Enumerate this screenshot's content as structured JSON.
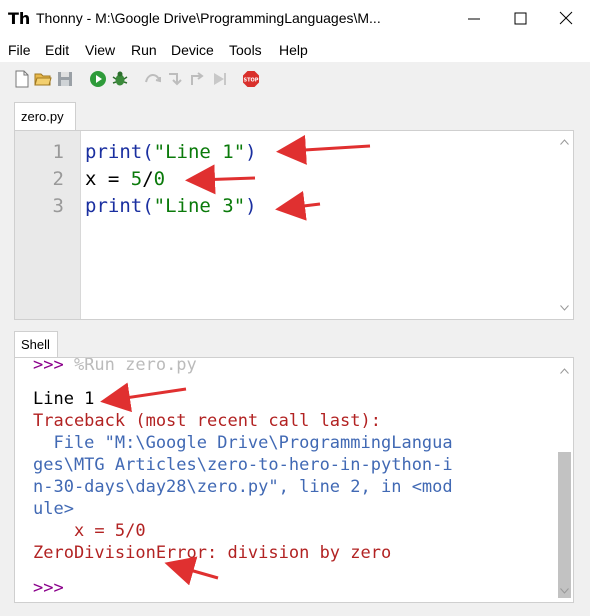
{
  "window": {
    "title": "Thonny  -  M:\\Google Drive\\ProgrammingLanguages\\M..."
  },
  "menu": [
    "File",
    "Edit",
    "View",
    "Run",
    "Device",
    "Tools",
    "Help"
  ],
  "editor": {
    "tab": "zero.py",
    "lines": [
      {
        "num": "1",
        "parts": [
          {
            "t": "print(",
            "c": "#1a2fa0"
          },
          {
            "t": "\"Line 1\"",
            "c": "#0a7a0a"
          },
          {
            "t": ")",
            "c": "#1a2fa0"
          }
        ]
      },
      {
        "num": "2",
        "parts": [
          {
            "t": "x = ",
            "c": "#000000"
          },
          {
            "t": "5",
            "c": "#0a7a0a"
          },
          {
            "t": "/",
            "c": "#000000"
          },
          {
            "t": "0",
            "c": "#0a7a0a"
          }
        ]
      },
      {
        "num": "3",
        "parts": [
          {
            "t": "print(",
            "c": "#1a2fa0"
          },
          {
            "t": "\"Line 3\"",
            "c": "#0a7a0a"
          },
          {
            "t": ")",
            "c": "#1a2fa0"
          }
        ]
      }
    ]
  },
  "shell": {
    "tab": "Shell",
    "run_cmd": ">>> %Run zero.py",
    "output_line": "Line 1",
    "traceback": "Traceback (most recent call last):",
    "file_lines": [
      "  File \"M:\\Google Drive\\ProgrammingLangua",
      "ges\\MTG Articles\\zero-to-hero-in-python-i",
      "n-30-days\\day28\\zero.py\", line 2, in <mod",
      "ule>"
    ],
    "code_line": "    x = 5/0",
    "error": "ZeroDivisionError: division by zero",
    "prompt": ">>>"
  },
  "colors": {
    "prompt": "#8b008b",
    "error": "#b22222",
    "path": "#4169b4",
    "output": "#000000",
    "arrow": "#e03030"
  }
}
